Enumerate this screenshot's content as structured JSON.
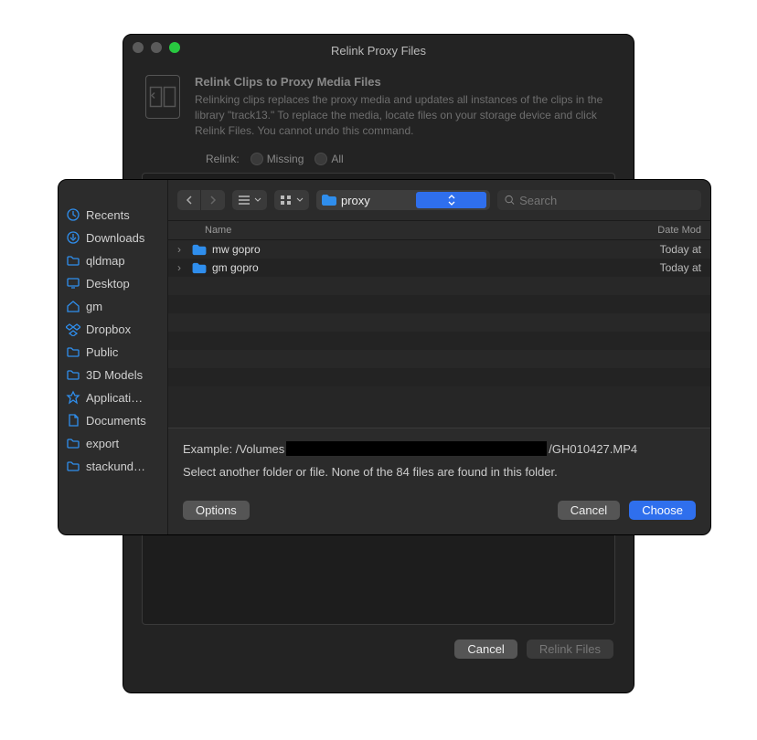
{
  "bgwin": {
    "title": "Relink Proxy Files",
    "intro_heading": "Relink Clips to Proxy Media Files",
    "intro_body": "Relinking clips replaces the proxy media and updates all instances of the clips in the library \"track13.\" To replace the media, locate files on your storage device and click Relink Files. You cannot undo this command.",
    "relink_label": "Relink:",
    "radio_missing": "Missing",
    "radio_all": "All",
    "cancel": "Cancel",
    "relink_files": "Relink Files"
  },
  "sidebar": [
    {
      "icon": "clock",
      "label": "Recents"
    },
    {
      "icon": "download",
      "label": "Downloads"
    },
    {
      "icon": "folder",
      "label": "qldmap"
    },
    {
      "icon": "desktop",
      "label": "Desktop"
    },
    {
      "icon": "home",
      "label": "gm"
    },
    {
      "icon": "dropbox",
      "label": "Dropbox"
    },
    {
      "icon": "folder",
      "label": "Public"
    },
    {
      "icon": "folder",
      "label": "3D Models"
    },
    {
      "icon": "app",
      "label": "Applicati…"
    },
    {
      "icon": "doc",
      "label": "Documents"
    },
    {
      "icon": "folder",
      "label": "export"
    },
    {
      "icon": "folder",
      "label": "stackund…"
    }
  ],
  "toolbar": {
    "path_folder": "proxy",
    "search_placeholder": "Search"
  },
  "columns": {
    "name": "Name",
    "date": "Date Mod"
  },
  "files": [
    {
      "name": "mw gopro",
      "date": "Today at"
    },
    {
      "name": "gm gopro",
      "date": "Today at"
    }
  ],
  "info": {
    "example_prefix": "Example: /Volumes",
    "example_suffix": "/GH010427.MP4",
    "message": "Select another folder or file. None of the 84 files are found in this folder."
  },
  "buttons": {
    "options": "Options",
    "cancel": "Cancel",
    "choose": "Choose"
  }
}
